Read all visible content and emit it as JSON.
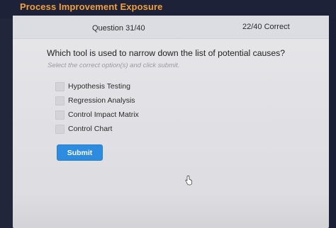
{
  "app": {
    "title": "Process Improvement Exposure"
  },
  "header": {
    "question_counter": "Question 31/40",
    "correct_counter": "22/40 Correct"
  },
  "question": {
    "text": "Which tool is used to narrow down the list of potential causes?",
    "instruction": "Select the correct option(s) and click submit."
  },
  "options": [
    {
      "label": "Hypothesis Testing",
      "checked": false
    },
    {
      "label": "Regression Analysis",
      "checked": false
    },
    {
      "label": "Control Impact Matrix",
      "checked": false
    },
    {
      "label": "Control Chart",
      "checked": false
    }
  ],
  "actions": {
    "submit_label": "Submit"
  },
  "colors": {
    "title": "#f1a03a",
    "accent": "#2e8ce0",
    "panel_background": "#e5e5e8",
    "frame": "#1d2238"
  },
  "icons": {
    "cursor": "hand-pointer-icon"
  }
}
